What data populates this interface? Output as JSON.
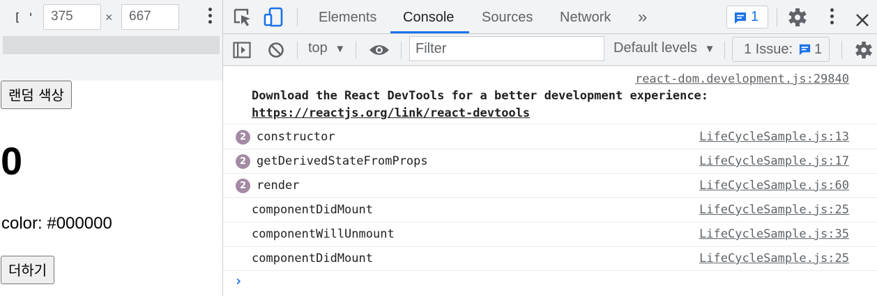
{
  "device_toolbar": {
    "glyph": "[ '",
    "width_value": "375",
    "times": "×",
    "height_value": "667"
  },
  "page": {
    "random_color_button": "랜덤 색상",
    "number": "0",
    "color_text": "color: #000000",
    "add_button": "더하기"
  },
  "devtools": {
    "tabs": [
      {
        "label": "Elements"
      },
      {
        "label": "Console"
      },
      {
        "label": "Sources"
      },
      {
        "label": "Network"
      }
    ],
    "more_tabs": "»",
    "message_count": "1",
    "context": "top",
    "filter_placeholder": "Filter",
    "default_levels": "Default levels",
    "issues_label": "1 Issue:",
    "issues_count": "1"
  },
  "console": {
    "devtools_notice": {
      "source": "react-dom.development.js:29840",
      "text": "Download the React DevTools for a better development experience: ",
      "link": "https://reactjs.org/link/react-devtools"
    },
    "messages": [
      {
        "count": "2",
        "text": "constructor",
        "source": "LifeCycleSample.js:13"
      },
      {
        "count": "2",
        "text": "getDerivedStateFromProps",
        "source": "LifeCycleSample.js:17"
      },
      {
        "count": "2",
        "text": "render",
        "source": "LifeCycleSample.js:60"
      },
      {
        "count": "",
        "text": "componentDidMount",
        "source": "LifeCycleSample.js:25"
      },
      {
        "count": "",
        "text": "componentWillUnmount",
        "source": "LifeCycleSample.js:35"
      },
      {
        "count": "",
        "text": "componentDidMount",
        "source": "LifeCycleSample.js:25"
      }
    ],
    "prompt": "›"
  }
}
